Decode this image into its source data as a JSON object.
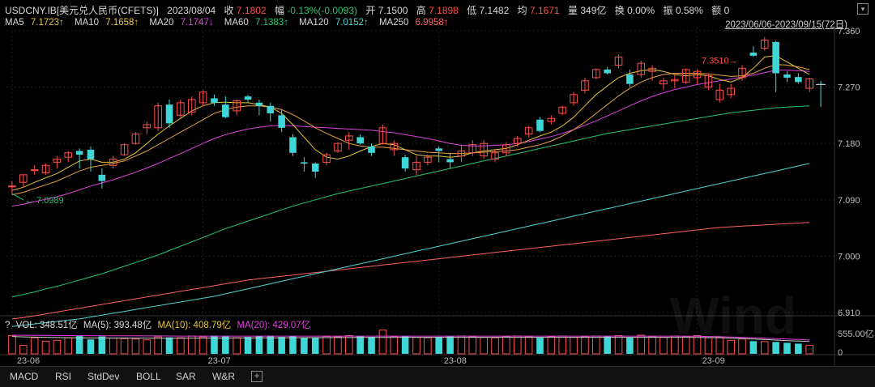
{
  "header": {
    "symbol": "USDCNY.IB[美元兑人民币(CFETS)]",
    "date": "2023/08/04",
    "close_label": "收",
    "close": "7.1802",
    "change_label": "幅",
    "change": "-0.13%(-0.0093)",
    "open_label": "开",
    "open": "7.1500",
    "high_label": "高",
    "high": "7.1898",
    "low_label": "低",
    "low": "7.1482",
    "avg_label": "均",
    "avg": "7.1671",
    "volume_label": "量",
    "volume": "349亿",
    "turnover_label": "换",
    "turnover": "0.00%",
    "amplitude_label": "振",
    "amplitude": "0.58%",
    "amount_label": "额",
    "amount": "0",
    "range": "2023/06/06-2023/09/15(72日)"
  },
  "ma_legend": [
    {
      "label": "MA5",
      "value": "7.1723↑",
      "color": "#e8c53a"
    },
    {
      "label": "MA10",
      "value": "7.1658↑",
      "color": "#e8c53a"
    },
    {
      "label": "MA20",
      "value": "7.1747↓",
      "color": "#e040e0"
    },
    {
      "label": "MA60",
      "value": "7.1383↑",
      "color": "#27c46e"
    },
    {
      "label": "MA120",
      "value": "7.0152↑",
      "color": "#4fd2d2"
    },
    {
      "label": "MA250",
      "value": "6.9958↑",
      "color": "#ff6060"
    }
  ],
  "volume_legend": {
    "prefix": "?",
    "vol": "VOL: 348.51亿",
    "ma5": "MA(5): 393.48亿",
    "ma10": "MA(10): 408.79亿",
    "ma20": "MA(20): 429.07亿"
  },
  "tabs": [
    "MACD",
    "RSI",
    "StdDev",
    "BOLL",
    "SAR",
    "W&R"
  ],
  "tab_add": "+",
  "watermark": "Wind",
  "colors": {
    "up": "#ff4d4d",
    "down": "#3ed6d6",
    "ma5": "#e8c53a",
    "ma10": "#e8a040",
    "ma20": "#e040e0",
    "ma60": "#27c46e",
    "ma120": "#4fd2d2",
    "ma250": "#ff6060"
  },
  "chart_data": {
    "type": "candlestick",
    "y_ticks": [
      "7.360",
      "7.270",
      "7.180",
      "7.090",
      "7.000",
      "6.910"
    ],
    "ylim": [
      6.905,
      7.365
    ],
    "x_ticks": [
      {
        "label": "23-06",
        "index": 0
      },
      {
        "label": "23-07",
        "index": 17
      },
      {
        "label": "23-08",
        "index": 38
      },
      {
        "label": "23-09",
        "index": 61
      }
    ],
    "volume_ticks": [
      "555.00亿",
      "0"
    ],
    "volume_ylim": [
      0,
      555
    ],
    "annotations": {
      "low_label": "7.0989",
      "low_index": 0,
      "high_label": "7.3510",
      "high_index": 65
    },
    "candles": [
      {
        "o": 7.112,
        "h": 7.12,
        "l": 7.1,
        "c": 7.112
      },
      {
        "o": 7.118,
        "h": 7.131,
        "l": 7.11,
        "c": 7.13
      },
      {
        "o": 7.137,
        "h": 7.145,
        "l": 7.13,
        "c": 7.138
      },
      {
        "o": 7.133,
        "h": 7.148,
        "l": 7.13,
        "c": 7.145
      },
      {
        "o": 7.15,
        "h": 7.16,
        "l": 7.14,
        "c": 7.155
      },
      {
        "o": 7.158,
        "h": 7.168,
        "l": 7.15,
        "c": 7.165
      },
      {
        "o": 7.168,
        "h": 7.172,
        "l": 7.14,
        "c": 7.162
      },
      {
        "o": 7.17,
        "h": 7.175,
        "l": 7.135,
        "c": 7.155
      },
      {
        "o": 7.13,
        "h": 7.14,
        "l": 7.108,
        "c": 7.12
      },
      {
        "o": 7.145,
        "h": 7.16,
        "l": 7.14,
        "c": 7.155
      },
      {
        "o": 7.162,
        "h": 7.18,
        "l": 7.16,
        "c": 7.178
      },
      {
        "o": 7.18,
        "h": 7.198,
        "l": 7.178,
        "c": 7.195
      },
      {
        "o": 7.205,
        "h": 7.215,
        "l": 7.195,
        "c": 7.21
      },
      {
        "o": 7.205,
        "h": 7.245,
        "l": 7.2,
        "c": 7.24
      },
      {
        "o": 7.242,
        "h": 7.25,
        "l": 7.205,
        "c": 7.212
      },
      {
        "o": 7.225,
        "h": 7.25,
        "l": 7.22,
        "c": 7.245
      },
      {
        "o": 7.23,
        "h": 7.255,
        "l": 7.225,
        "c": 7.25
      },
      {
        "o": 7.245,
        "h": 7.265,
        "l": 7.24,
        "c": 7.262
      },
      {
        "o": 7.252,
        "h": 7.258,
        "l": 7.24,
        "c": 7.245
      },
      {
        "o": 7.242,
        "h": 7.255,
        "l": 7.22,
        "c": 7.222
      },
      {
        "o": 7.232,
        "h": 7.25,
        "l": 7.225,
        "c": 7.248
      },
      {
        "o": 7.255,
        "h": 7.258,
        "l": 7.245,
        "c": 7.25
      },
      {
        "o": 7.245,
        "h": 7.25,
        "l": 7.225,
        "c": 7.24
      },
      {
        "o": 7.24,
        "h": 7.245,
        "l": 7.215,
        "c": 7.228
      },
      {
        "o": 7.225,
        "h": 7.235,
        "l": 7.198,
        "c": 7.205
      },
      {
        "o": 7.19,
        "h": 7.195,
        "l": 7.16,
        "c": 7.165
      },
      {
        "o": 7.15,
        "h": 7.158,
        "l": 7.135,
        "c": 7.148
      },
      {
        "o": 7.148,
        "h": 7.15,
        "l": 7.125,
        "c": 7.135
      },
      {
        "o": 7.15,
        "h": 7.165,
        "l": 7.145,
        "c": 7.162
      },
      {
        "o": 7.168,
        "h": 7.182,
        "l": 7.165,
        "c": 7.18
      },
      {
        "o": 7.185,
        "h": 7.198,
        "l": 7.17,
        "c": 7.192
      },
      {
        "o": 7.19,
        "h": 7.195,
        "l": 7.178,
        "c": 7.18
      },
      {
        "o": 7.175,
        "h": 7.18,
        "l": 7.16,
        "c": 7.165
      },
      {
        "o": 7.18,
        "h": 7.21,
        "l": 7.178,
        "c": 7.205
      },
      {
        "o": 7.17,
        "h": 7.185,
        "l": 7.16,
        "c": 7.18
      },
      {
        "o": 7.158,
        "h": 7.162,
        "l": 7.135,
        "c": 7.14
      },
      {
        "o": 7.138,
        "h": 7.16,
        "l": 7.13,
        "c": 7.15
      },
      {
        "o": 7.15,
        "h": 7.162,
        "l": 7.145,
        "c": 7.158
      },
      {
        "o": 7.172,
        "h": 7.175,
        "l": 7.15,
        "c": 7.168
      },
      {
        "o": 7.155,
        "h": 7.165,
        "l": 7.14,
        "c": 7.15
      },
      {
        "o": 7.16,
        "h": 7.178,
        "l": 7.15,
        "c": 7.168
      },
      {
        "o": 7.165,
        "h": 7.185,
        "l": 7.16,
        "c": 7.178
      },
      {
        "o": 7.16,
        "h": 7.185,
        "l": 7.155,
        "c": 7.18
      },
      {
        "o": 7.155,
        "h": 7.17,
        "l": 7.15,
        "c": 7.165
      },
      {
        "o": 7.165,
        "h": 7.182,
        "l": 7.16,
        "c": 7.178
      },
      {
        "o": 7.18,
        "h": 7.192,
        "l": 7.175,
        "c": 7.188
      },
      {
        "o": 7.195,
        "h": 7.208,
        "l": 7.19,
        "c": 7.205
      },
      {
        "o": 7.218,
        "h": 7.222,
        "l": 7.198,
        "c": 7.2
      },
      {
        "o": 7.215,
        "h": 7.225,
        "l": 7.21,
        "c": 7.22
      },
      {
        "o": 7.228,
        "h": 7.24,
        "l": 7.225,
        "c": 7.238
      },
      {
        "o": 7.245,
        "h": 7.262,
        "l": 7.24,
        "c": 7.258
      },
      {
        "o": 7.265,
        "h": 7.285,
        "l": 7.26,
        "c": 7.28
      },
      {
        "o": 7.285,
        "h": 7.3,
        "l": 7.282,
        "c": 7.298
      },
      {
        "o": 7.298,
        "h": 7.302,
        "l": 7.29,
        "c": 7.292
      },
      {
        "o": 7.305,
        "h": 7.322,
        "l": 7.3,
        "c": 7.318
      },
      {
        "o": 7.29,
        "h": 7.298,
        "l": 7.27,
        "c": 7.275
      },
      {
        "o": 7.29,
        "h": 7.312,
        "l": 7.285,
        "c": 7.308
      },
      {
        "o": 7.295,
        "h": 7.305,
        "l": 7.28,
        "c": 7.3
      },
      {
        "o": 7.275,
        "h": 7.285,
        "l": 7.265,
        "c": 7.28
      },
      {
        "o": 7.28,
        "h": 7.29,
        "l": 7.268,
        "c": 7.282
      },
      {
        "o": 7.278,
        "h": 7.3,
        "l": 7.275,
        "c": 7.298
      },
      {
        "o": 7.285,
        "h": 7.298,
        "l": 7.275,
        "c": 7.295
      },
      {
        "o": 7.27,
        "h": 7.292,
        "l": 7.265,
        "c": 7.288
      },
      {
        "o": 7.25,
        "h": 7.275,
        "l": 7.245,
        "c": 7.265
      },
      {
        "o": 7.258,
        "h": 7.275,
        "l": 7.252,
        "c": 7.268
      },
      {
        "o": 7.285,
        "h": 7.305,
        "l": 7.28,
        "c": 7.3
      },
      {
        "o": 7.325,
        "h": 7.335,
        "l": 7.318,
        "c": 7.32
      },
      {
        "o": 7.332,
        "h": 7.35,
        "l": 7.328,
        "c": 7.345
      },
      {
        "o": 7.342,
        "h": 7.344,
        "l": 7.262,
        "c": 7.292
      },
      {
        "o": 7.29,
        "h": 7.295,
        "l": 7.278,
        "c": 7.285
      },
      {
        "o": 7.286,
        "h": 7.292,
        "l": 7.275,
        "c": 7.278
      },
      {
        "o": 7.268,
        "h": 7.285,
        "l": 7.262,
        "c": 7.283
      },
      {
        "o": 7.275,
        "h": 7.28,
        "l": 7.238,
        "c": 7.274
      }
    ],
    "volumes": [
      430,
      200,
      380,
      300,
      320,
      380,
      420,
      340,
      410,
      370,
      360,
      350,
      330,
      400,
      390,
      380,
      420,
      400,
      430,
      410,
      380,
      400,
      420,
      430,
      400,
      420,
      380,
      390,
      410,
      400,
      430,
      420,
      400,
      560,
      410,
      420,
      390,
      380,
      400,
      410,
      420,
      400,
      390,
      380,
      410,
      420,
      400,
      380,
      410,
      420,
      390,
      400,
      420,
      410,
      430,
      380,
      440,
      400,
      390,
      420,
      410,
      430,
      380,
      400,
      320,
      350,
      300,
      290,
      280,
      260,
      240,
      200
    ],
    "ma_series": {
      "ma5": [
        7.105,
        7.11,
        7.118,
        7.125,
        7.132,
        7.142,
        7.152,
        7.155,
        7.15,
        7.15,
        7.155,
        7.165,
        7.18,
        7.195,
        7.208,
        7.22,
        7.232,
        7.24,
        7.245,
        7.246,
        7.245,
        7.245,
        7.242,
        7.238,
        7.228,
        7.21,
        7.19,
        7.17,
        7.158,
        7.155,
        7.16,
        7.168,
        7.175,
        7.18,
        7.178,
        7.17,
        7.162,
        7.16,
        7.16,
        7.158,
        7.16,
        7.165,
        7.168,
        7.17,
        7.172,
        7.178,
        7.185,
        7.192,
        7.198,
        7.208,
        7.222,
        7.24,
        7.258,
        7.272,
        7.285,
        7.292,
        7.296,
        7.298,
        7.295,
        7.29,
        7.288,
        7.29,
        7.288,
        7.282,
        7.278,
        7.285,
        7.3,
        7.318,
        7.32,
        7.31,
        7.3,
        7.29
      ],
      "ma10": [
        7.098,
        7.102,
        7.108,
        7.114,
        7.12,
        7.128,
        7.136,
        7.142,
        7.145,
        7.148,
        7.152,
        7.16,
        7.168,
        7.178,
        7.188,
        7.198,
        7.208,
        7.218,
        7.228,
        7.234,
        7.238,
        7.24,
        7.24,
        7.238,
        7.234,
        7.226,
        7.216,
        7.205,
        7.196,
        7.188,
        7.18,
        7.176,
        7.174,
        7.174,
        7.172,
        7.17,
        7.168,
        7.166,
        7.165,
        7.164,
        7.164,
        7.165,
        7.166,
        7.167,
        7.168,
        7.17,
        7.174,
        7.178,
        7.184,
        7.192,
        7.202,
        7.214,
        7.228,
        7.242,
        7.256,
        7.268,
        7.278,
        7.285,
        7.29,
        7.292,
        7.292,
        7.292,
        7.291,
        7.289,
        7.287,
        7.288,
        7.292,
        7.3,
        7.306,
        7.305,
        7.302,
        7.298
      ],
      "ma20": [
        7.08,
        7.083,
        7.087,
        7.091,
        7.095,
        7.1,
        7.106,
        7.112,
        7.117,
        7.122,
        7.128,
        7.134,
        7.141,
        7.148,
        7.156,
        7.164,
        7.172,
        7.18,
        7.188,
        7.194,
        7.199,
        7.203,
        7.206,
        7.208,
        7.209,
        7.208,
        7.207,
        7.206,
        7.205,
        7.204,
        7.203,
        7.202,
        7.201,
        7.199,
        7.197,
        7.194,
        7.191,
        7.188,
        7.184,
        7.18,
        7.177,
        7.176,
        7.176,
        7.177,
        7.178,
        7.18,
        7.183,
        7.187,
        7.191,
        7.196,
        7.202,
        7.209,
        7.216,
        7.224,
        7.232,
        7.24,
        7.248,
        7.255,
        7.261,
        7.266,
        7.27,
        7.274,
        7.277,
        7.28,
        7.283,
        7.286,
        7.289,
        7.293,
        7.297,
        7.297,
        7.296,
        7.295
      ],
      "ma60": [
        6.935,
        6.939,
        6.943,
        6.948,
        6.952,
        6.957,
        6.962,
        6.967,
        6.972,
        6.978,
        6.984,
        6.99,
        6.996,
        7.002,
        7.009,
        7.016,
        7.023,
        7.03,
        7.037,
        7.044,
        7.05,
        7.056,
        7.062,
        7.068,
        7.074,
        7.08,
        7.085,
        7.09,
        7.095,
        7.1,
        7.104,
        7.108,
        7.112,
        7.116,
        7.12,
        7.124,
        7.128,
        7.132,
        7.136,
        7.14,
        7.144,
        7.148,
        7.152,
        7.156,
        7.16,
        7.164,
        7.168,
        7.172,
        7.176,
        7.18,
        7.184,
        7.188,
        7.192,
        7.196,
        7.199,
        7.202,
        7.205,
        7.208,
        7.211,
        7.214,
        7.217,
        7.22,
        7.223,
        7.226,
        7.229,
        7.231,
        7.233,
        7.235,
        7.237,
        7.238,
        7.239,
        7.24
      ],
      "ma120": [
        6.888,
        6.89,
        6.892,
        6.894,
        6.896,
        6.898,
        6.9,
        6.903,
        6.906,
        6.909,
        6.912,
        6.915,
        6.918,
        6.921,
        6.924,
        6.927,
        6.93,
        6.933,
        6.936,
        6.94,
        6.944,
        6.948,
        6.952,
        6.956,
        6.96,
        6.964,
        6.968,
        6.972,
        6.976,
        6.98,
        6.984,
        6.988,
        6.992,
        6.996,
        7.0,
        7.004,
        7.008,
        7.012,
        7.016,
        7.02,
        7.024,
        7.028,
        7.032,
        7.036,
        7.04,
        7.044,
        7.048,
        7.052,
        7.056,
        7.06,
        7.064,
        7.068,
        7.072,
        7.076,
        7.08,
        7.084,
        7.088,
        7.092,
        7.096,
        7.1,
        7.104,
        7.108,
        7.112,
        7.116,
        7.12,
        7.124,
        7.128,
        7.132,
        7.136,
        7.14,
        7.144,
        7.148
      ],
      "ma250": [
        6.9,
        6.902,
        6.905,
        6.908,
        6.911,
        6.914,
        6.917,
        6.92,
        6.923,
        6.926,
        6.929,
        6.932,
        6.935,
        6.938,
        6.941,
        6.944,
        6.947,
        6.95,
        6.953,
        6.956,
        6.959,
        6.962,
        6.964,
        6.966,
        6.968,
        6.97,
        6.972,
        6.974,
        6.976,
        6.978,
        6.98,
        6.982,
        6.984,
        6.986,
        6.988,
        6.99,
        6.992,
        6.994,
        6.996,
        6.998,
        7.0,
        7.002,
        7.004,
        7.006,
        7.008,
        7.01,
        7.012,
        7.014,
        7.016,
        7.018,
        7.02,
        7.022,
        7.024,
        7.026,
        7.028,
        7.03,
        7.032,
        7.034,
        7.036,
        7.038,
        7.04,
        7.042,
        7.044,
        7.046,
        7.047,
        7.048,
        7.049,
        7.05,
        7.051,
        7.052,
        7.053,
        7.054
      ]
    },
    "vol_ma_series": {
      "ma5": [
        410,
        400,
        395,
        390,
        385,
        380,
        378,
        376,
        375,
        374,
        373,
        372,
        371,
        370,
        370,
        370,
        371,
        372,
        373,
        374,
        375,
        376,
        377,
        378,
        379,
        380,
        381,
        382,
        383,
        384,
        385,
        386,
        387,
        388,
        389,
        390,
        390,
        390,
        390,
        390,
        390,
        390,
        390,
        390,
        390,
        390,
        390,
        390,
        390,
        390,
        390,
        390,
        390,
        390,
        390,
        390,
        390,
        390,
        390,
        390,
        390,
        388,
        385,
        380,
        372,
        362,
        350,
        338,
        325,
        312,
        300,
        290
      ],
      "ma20": [
        440,
        438,
        436,
        434,
        432,
        430,
        429,
        428,
        427,
        426,
        425,
        424,
        423,
        422,
        421,
        420,
        420,
        420,
        420,
        420,
        420,
        420,
        420,
        420,
        420,
        420,
        420,
        420,
        420,
        420,
        420,
        420,
        420,
        420,
        420,
        420,
        420,
        420,
        420,
        420,
        420,
        420,
        420,
        420,
        420,
        420,
        420,
        420,
        420,
        420,
        420,
        420,
        420,
        420,
        420,
        420,
        420,
        420,
        420,
        420,
        418,
        415,
        410,
        405,
        398,
        390,
        380,
        370,
        360,
        350,
        340,
        330
      ]
    }
  }
}
